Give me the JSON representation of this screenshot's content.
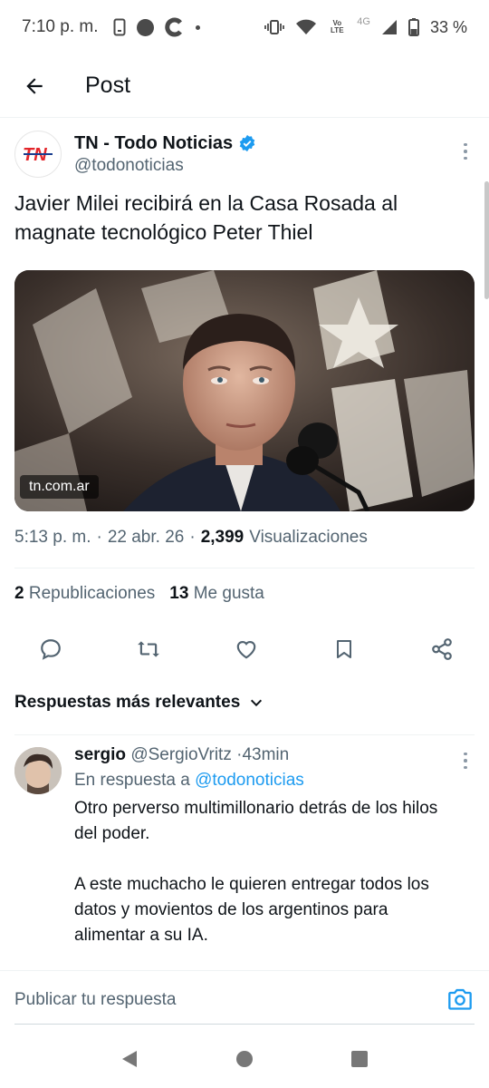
{
  "status_bar": {
    "time": "7:10 p. m.",
    "network": "4G",
    "volte": "Vo LTE",
    "battery": "33 %"
  },
  "header": {
    "title": "Post"
  },
  "post": {
    "author_name": "TN - Todo Noticias",
    "author_handle": "@todonoticias",
    "verified": true,
    "text": "Javier Milei recibirá en la Casa Rosada al magnate tecnológico Peter Thiel",
    "media_domain": "tn.com.ar",
    "time": "5:13 p. m.",
    "date": "22 abr. 26",
    "views_count": "2,399",
    "views_label": "Visualizaciones",
    "reposts_count": "2",
    "reposts_label": "Republicaciones",
    "likes_count": "13",
    "likes_label": "Me gusta"
  },
  "sort": {
    "label": "Respuestas más relevantes"
  },
  "reply": {
    "name": "sergio",
    "handle": "@SergioVritz",
    "time": "43min",
    "replying_prefix": "En respuesta a",
    "replying_to": "@todonoticias",
    "paragraph_1": "Otro perverso multimillonario detrás de los hilos del poder.",
    "paragraph_2": "A este muchacho le quieren entregar todos los datos y movientos de los argentinos para alimentar a su IA."
  },
  "compose": {
    "placeholder": "Publicar tu respuesta"
  },
  "colors": {
    "accent": "#1d9bf0",
    "text": "#0f1419",
    "secondary": "#536471"
  }
}
